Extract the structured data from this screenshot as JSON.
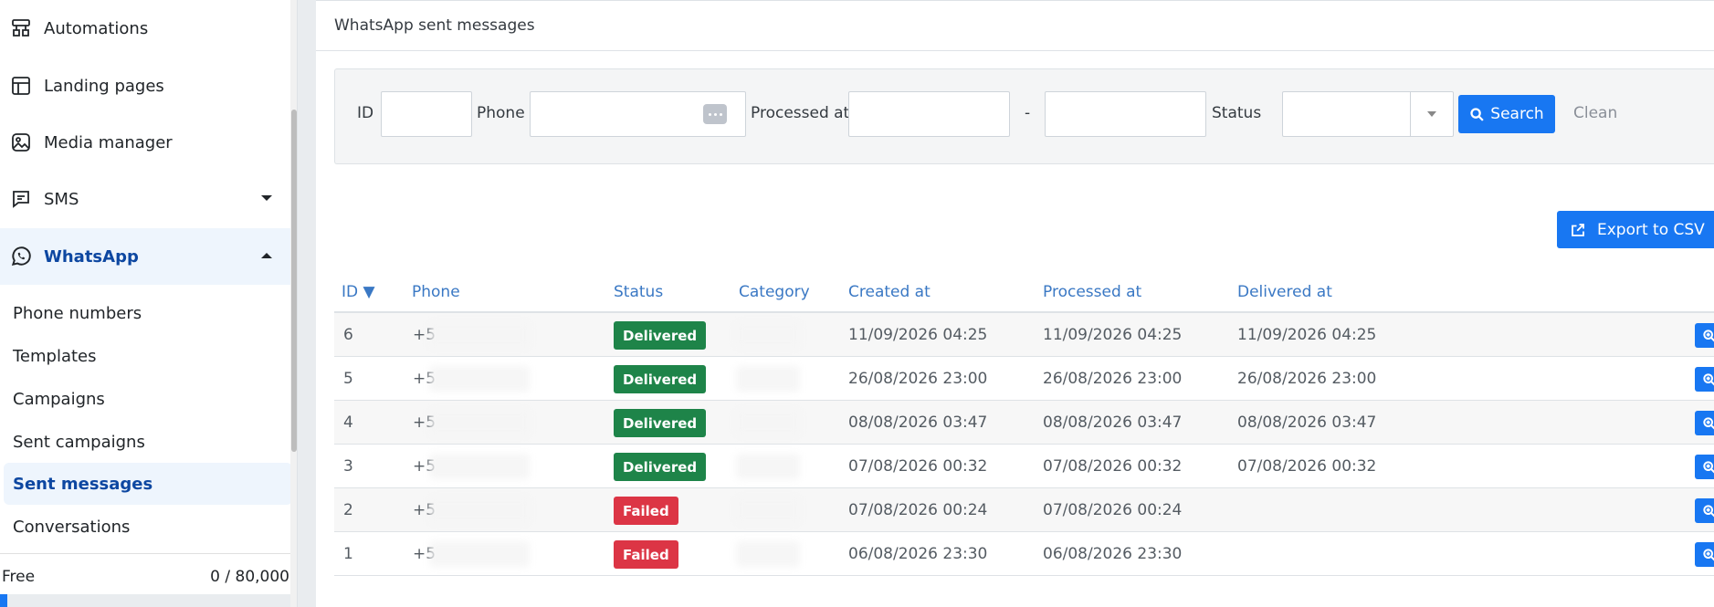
{
  "sidebar": {
    "items": [
      {
        "label": "Automations",
        "icon": "automations-icon"
      },
      {
        "label": "Landing pages",
        "icon": "landing-pages-icon"
      },
      {
        "label": "Media manager",
        "icon": "media-manager-icon"
      },
      {
        "label": "SMS",
        "icon": "sms-icon"
      },
      {
        "label": "WhatsApp",
        "icon": "whatsapp-icon"
      }
    ],
    "whatsapp_submenu": [
      "Phone numbers",
      "Templates",
      "Campaigns",
      "Sent campaigns",
      "Sent messages",
      "Conversations"
    ],
    "plan": {
      "label": "Free",
      "usage": "0 / 80,000",
      "usage_fraction": 0.0
    }
  },
  "page": {
    "title": "WhatsApp sent messages"
  },
  "filters": {
    "id_label": "ID",
    "phone_label": "Phone",
    "processed_label": "Processed at",
    "range_separator": "-",
    "status_label": "Status",
    "search_label": "Search",
    "clean_label": "Clean"
  },
  "toolbar": {
    "export_label": "Export to CSV"
  },
  "table": {
    "columns": [
      "ID ▼",
      "Phone",
      "Status",
      "Category",
      "Created at",
      "Processed at",
      "Delivered at"
    ],
    "rows": [
      {
        "id": "6",
        "phone": "+5",
        "status": "Delivered",
        "created": "11/09/2026 04:25",
        "processed": "11/09/2026 04:25",
        "delivered": "11/09/2026 04:25"
      },
      {
        "id": "5",
        "phone": "+5",
        "status": "Delivered",
        "created": "26/08/2026 23:00",
        "processed": "26/08/2026 23:00",
        "delivered": "26/08/2026 23:00"
      },
      {
        "id": "4",
        "phone": "+5",
        "status": "Delivered",
        "created": "08/08/2026 03:47",
        "processed": "08/08/2026 03:47",
        "delivered": "08/08/2026 03:47"
      },
      {
        "id": "3",
        "phone": "+5",
        "status": "Delivered",
        "created": "07/08/2026 00:32",
        "processed": "07/08/2026 00:32",
        "delivered": "07/08/2026 00:32"
      },
      {
        "id": "2",
        "phone": "+5",
        "status": "Failed",
        "created": "07/08/2026 00:24",
        "processed": "07/08/2026 00:24",
        "delivered": ""
      },
      {
        "id": "1",
        "phone": "+5",
        "status": "Failed",
        "created": "06/08/2026 23:30",
        "processed": "06/08/2026 23:30",
        "delivered": ""
      }
    ]
  },
  "colors": {
    "primary": "#1877f2",
    "delivered": "#1e8449",
    "failed": "#dc3545",
    "active_nav": "#0d47a1"
  }
}
